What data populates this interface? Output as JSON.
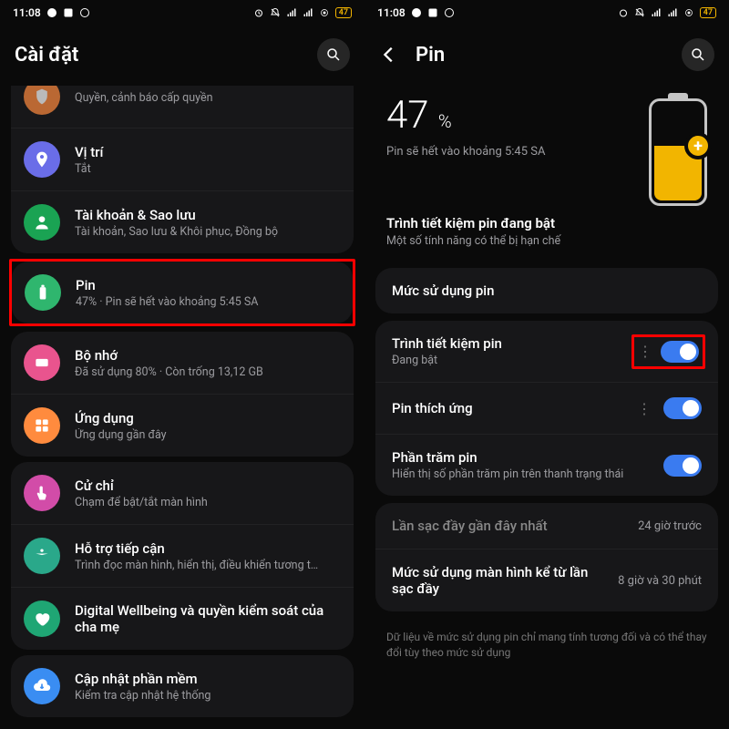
{
  "status": {
    "time": "11:08",
    "battery_pct": "47"
  },
  "left": {
    "title": "Cài đặt",
    "items": [
      {
        "id": "priv",
        "title": "",
        "sub": "Quyền, cảnh báo cấp quyền"
      },
      {
        "id": "loc",
        "title": "Vị trí",
        "sub": "Tắt"
      },
      {
        "id": "acct",
        "title": "Tài khoản & Sao lưu",
        "sub": "Tài khoản, Sao lưu & Khôi phục, Đồng bộ"
      },
      {
        "id": "bat",
        "title": "Pin",
        "sub": "47% · Pin sẽ hết vào khoảng 5:45 SA"
      },
      {
        "id": "stor",
        "title": "Bộ nhớ",
        "sub": "Đã sử dụng 80% · Còn trống 13,12 GB"
      },
      {
        "id": "apps",
        "title": "Ứng dụng",
        "sub": "Ứng dụng gần đây"
      },
      {
        "id": "gest",
        "title": "Cử chỉ",
        "sub": "Chạm để bật/tắt màn hình"
      },
      {
        "id": "acc",
        "title": "Hỗ trợ tiếp cận",
        "sub": "Trình đọc màn hình, hiển thị, điều khiển tương t…"
      },
      {
        "id": "dw",
        "title": "Digital Wellbeing và quyền kiểm soát của cha mẹ",
        "sub": ""
      },
      {
        "id": "upd",
        "title": "Cập nhật phần mềm",
        "sub": "Kiểm tra cập nhật hệ thống"
      }
    ]
  },
  "right": {
    "title": "Pin",
    "pct": "47",
    "pct_unit": "%",
    "estimate": "Pin sẽ hết vào khoảng 5:45 SA",
    "saver_on_title": "Trình tiết kiệm pin đang bật",
    "saver_on_sub": "Một số tính năng có thể bị hạn chế",
    "usage_label": "Mức sử dụng pin",
    "rows": {
      "saver": {
        "t": "Trình tiết kiệm pin",
        "s": "Đang bật"
      },
      "adapt": {
        "t": "Pin thích ứng"
      },
      "pct": {
        "t": "Phần trăm pin",
        "s": "Hiển thị số phần trăm pin trên thanh trạng thái"
      }
    },
    "info": {
      "last_full": {
        "t": "Lần sạc đầy gần đây nhất",
        "v": "24 giờ trước"
      },
      "screen_use": {
        "t": "Mức sử dụng màn hình kể từ lần sạc đầy",
        "v": "8 giờ và 30 phút"
      }
    },
    "footnote": "Dữ liệu về mức sử dụng pin chỉ mang tính tương đối và có thể thay đổi tùy theo mức sử dụng"
  }
}
